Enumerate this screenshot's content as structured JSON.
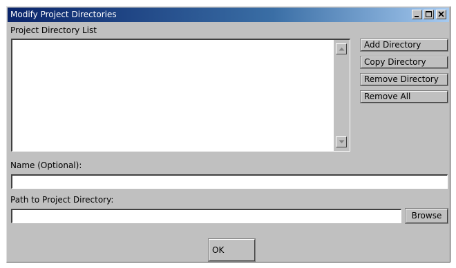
{
  "window": {
    "title": "Modify Project Directories"
  },
  "list": {
    "label": "Project Directory List",
    "items": []
  },
  "buttons": {
    "add": "Add Directory",
    "copy": "Copy Directory",
    "remove": "Remove Directory",
    "remove_all": "Remove All",
    "browse": "Browse",
    "ok": "OK"
  },
  "name_field": {
    "label": "Name (Optional):",
    "value": ""
  },
  "path_field": {
    "label": "Path to Project Directory:",
    "value": ""
  },
  "icons": {
    "minimize": "minimize-icon",
    "maximize": "maximize-icon",
    "close": "close-icon",
    "scroll_up": "arrow-up-icon",
    "scroll_down": "arrow-down-icon"
  },
  "colors": {
    "title_start": "#0a246a",
    "title_end": "#a6caf0",
    "face": "#c0c0c0"
  }
}
